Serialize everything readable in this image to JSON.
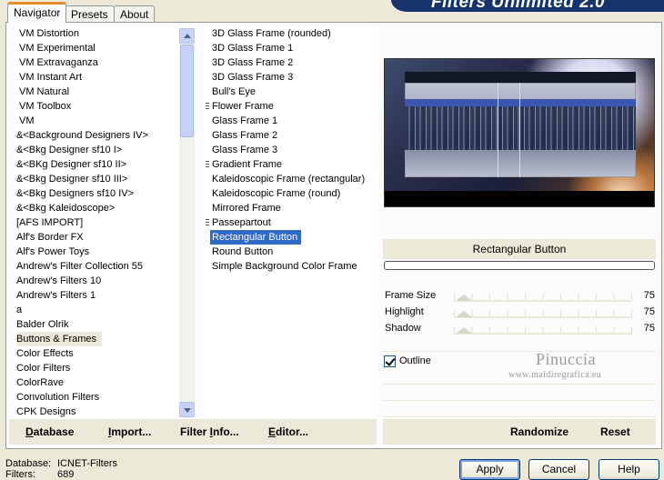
{
  "tabs": [
    {
      "label": "Navigator",
      "active": true
    },
    {
      "label": "Presets",
      "active": false
    },
    {
      "label": "About",
      "active": false
    }
  ],
  "banner_title": "Filters Unlimited 2.0",
  "categories": [
    "VM Distortion",
    "VM Experimental",
    "VM Extravaganza",
    "VM Instant Art",
    "VM Natural",
    "VM Toolbox",
    "VM",
    "&<Background Designers IV>",
    "&<Bkg Designer sf10 I>",
    "&<BKg Designer sf10 II>",
    "&<Bkg Designer sf10 III>",
    "&<Bkg Designers sf10 IV>",
    "&<Bkg Kaleidoscope>",
    "[AFS IMPORT]",
    "Alf's Border FX",
    "Alf's Power Toys",
    "Andrew's Filter Collection 55",
    "Andrew's Filters 10",
    "Andrew's Filters 1",
    "a",
    "Balder Olrik",
    "Buttons & Frames",
    "Color Effects",
    "Color Filters",
    "ColorRave",
    "Convolution Filters",
    "CPK Designs"
  ],
  "selected_category": "Buttons & Frames",
  "filters": [
    {
      "label": "3D Glass Frame (rounded)",
      "grip": false
    },
    {
      "label": "3D Glass Frame 1",
      "grip": false
    },
    {
      "label": "3D Glass Frame 2",
      "grip": false
    },
    {
      "label": "3D Glass Frame 3",
      "grip": false
    },
    {
      "label": "Bull's Eye",
      "grip": false
    },
    {
      "label": "Flower Frame",
      "grip": true
    },
    {
      "label": "Glass Frame 1",
      "grip": false
    },
    {
      "label": "Glass Frame 2",
      "grip": false
    },
    {
      "label": "Glass Frame 3",
      "grip": false
    },
    {
      "label": "Gradient Frame",
      "grip": true
    },
    {
      "label": "Kaleidoscopic Frame (rectangular)",
      "grip": false
    },
    {
      "label": "Kaleidoscopic Frame (round)",
      "grip": false
    },
    {
      "label": "Mirrored Frame",
      "grip": false
    },
    {
      "label": "Passepartout",
      "grip": true
    },
    {
      "label": "Rectangular Button",
      "grip": false
    },
    {
      "label": "Round Button",
      "grip": false
    },
    {
      "label": "Simple Background Color Frame",
      "grip": false
    }
  ],
  "selected_filter": "Rectangular Button",
  "left_buttons": {
    "database": {
      "first": "D",
      "rest": "atabase"
    },
    "import": {
      "first": "I",
      "rest": "mport..."
    },
    "filter_info": {
      "first": "Filter ",
      "u": "I",
      "rest": "nfo..."
    },
    "editor": {
      "first": "E",
      "rest": "ditor..."
    }
  },
  "preview_filter_name": "Rectangular Button",
  "params": [
    {
      "label": "Frame Size",
      "value": "75"
    },
    {
      "label": "Highlight",
      "value": "75"
    },
    {
      "label": "Shadow",
      "value": "75"
    }
  ],
  "outline": {
    "label": "Outline",
    "checked": true
  },
  "watermark": {
    "name": "Pinuccia",
    "site": "www.maidiregrafica.eu"
  },
  "right_buttons": {
    "randomize": "Randomize",
    "reset": "Reset"
  },
  "status": {
    "database_label": "Database:",
    "database_value": "ICNET-Filters",
    "filters_label": "Filters:",
    "filters_value": "689"
  },
  "dialog_buttons": {
    "apply": "Apply",
    "cancel": "Cancel",
    "help": "Help"
  }
}
